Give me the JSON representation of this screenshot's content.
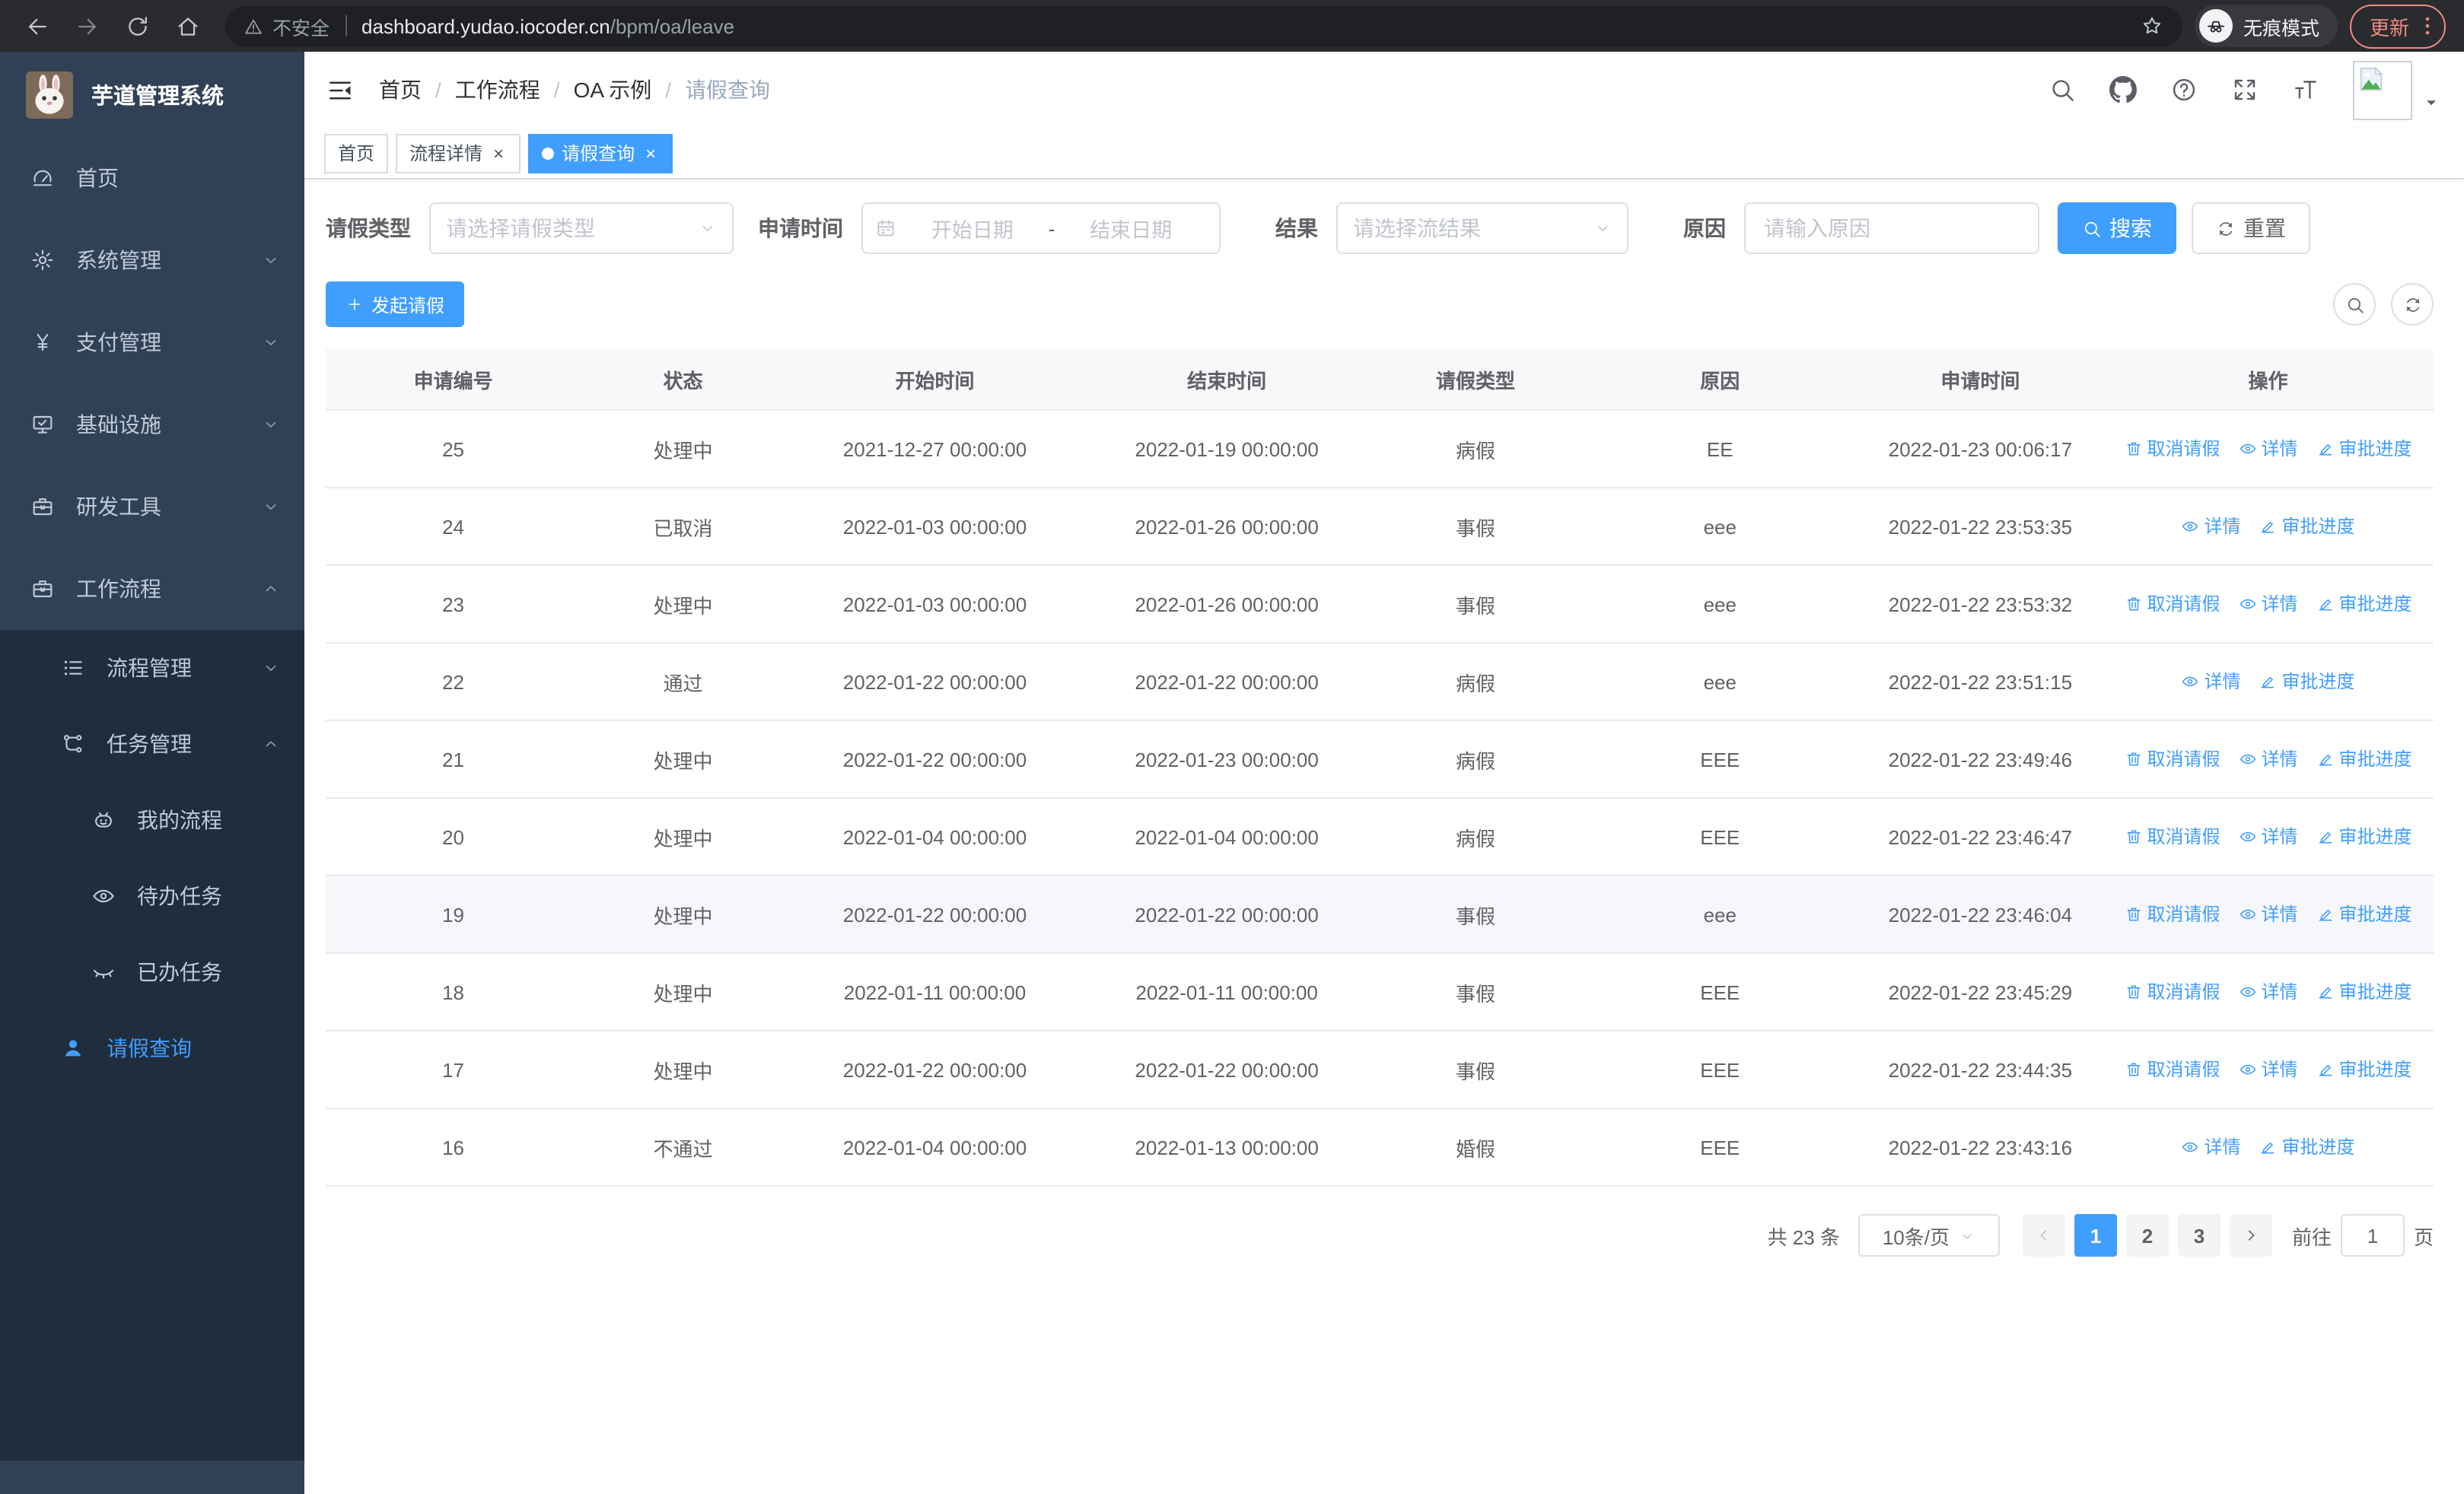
{
  "browser": {
    "nav_icons": [
      "back",
      "forward",
      "reload",
      "home"
    ],
    "security_label": "不安全",
    "url_host": "dashboard.yudao.iocoder.cn",
    "url_path": "/bpm/oa/leave",
    "incognito_label": "无痕模式",
    "update_label": "更新"
  },
  "sidebar": {
    "title": "芋道管理系统",
    "items": [
      {
        "label": "首页",
        "icon": "dashboard",
        "section": "top",
        "level": 0
      },
      {
        "label": "系统管理",
        "icon": "gear",
        "section": "top",
        "level": 0,
        "chevron": "down"
      },
      {
        "label": "支付管理",
        "icon": "yen",
        "section": "top",
        "level": 0,
        "chevron": "down"
      },
      {
        "label": "基础设施",
        "icon": "monitor",
        "section": "top",
        "level": 0,
        "chevron": "down"
      },
      {
        "label": "研发工具",
        "icon": "toolbox",
        "section": "top",
        "level": 0,
        "chevron": "down"
      },
      {
        "label": "工作流程",
        "icon": "toolbox",
        "section": "top",
        "level": 0,
        "chevron": "up"
      },
      {
        "label": "流程管理",
        "icon": "list",
        "section": "sub",
        "level": 1,
        "chevron": "down"
      },
      {
        "label": "任务管理",
        "icon": "flow",
        "section": "sub",
        "level": 1,
        "chevron": "up"
      },
      {
        "label": "我的流程",
        "icon": "robot",
        "section": "sub",
        "level": 2
      },
      {
        "label": "待办任务",
        "icon": "eye",
        "section": "sub",
        "level": 2
      },
      {
        "label": "已办任务",
        "icon": "eye-closed",
        "section": "sub",
        "level": 2
      },
      {
        "label": "请假查询",
        "icon": "user",
        "section": "sub",
        "level": 1,
        "active": true
      }
    ]
  },
  "header": {
    "breadcrumb": [
      "首页",
      "工作流程",
      "OA 示例",
      "请假查询"
    ],
    "right_icons": [
      "search",
      "github",
      "question",
      "fullscreen",
      "font-size"
    ]
  },
  "tabs": [
    {
      "label": "首页",
      "active": false,
      "closable": false
    },
    {
      "label": "流程详情",
      "active": false,
      "closable": true
    },
    {
      "label": "请假查询",
      "active": true,
      "closable": true
    }
  ],
  "filters": {
    "leave_type": {
      "label": "请假类型",
      "placeholder": "请选择请假类型"
    },
    "apply_time": {
      "label": "申请时间",
      "start_placeholder": "开始日期",
      "separator": "-",
      "end_placeholder": "结束日期"
    },
    "result": {
      "label": "结果",
      "placeholder": "请选择流结果"
    },
    "reason": {
      "label": "原因",
      "placeholder": "请输入原因"
    },
    "search_label": "搜索",
    "reset_label": "重置"
  },
  "toolbar": {
    "create_label": "发起请假"
  },
  "table": {
    "columns": [
      "申请编号",
      "状态",
      "开始时间",
      "结束时间",
      "请假类型",
      "原因",
      "申请时间",
      "操作"
    ],
    "action_labels": {
      "cancel": "取消请假",
      "detail": "详情",
      "progress": "审批进度"
    },
    "rows": [
      {
        "id": "25",
        "status": "处理中",
        "start": "2021-12-27 00:00:00",
        "end": "2022-01-19 00:00:00",
        "type": "病假",
        "reason": "EE",
        "apply": "2022-01-23 00:06:17",
        "actions": [
          "cancel",
          "detail",
          "progress"
        ],
        "hover": false
      },
      {
        "id": "24",
        "status": "已取消",
        "start": "2022-01-03 00:00:00",
        "end": "2022-01-26 00:00:00",
        "type": "事假",
        "reason": "eee",
        "apply": "2022-01-22 23:53:35",
        "actions": [
          "detail",
          "progress"
        ],
        "hover": false
      },
      {
        "id": "23",
        "status": "处理中",
        "start": "2022-01-03 00:00:00",
        "end": "2022-01-26 00:00:00",
        "type": "事假",
        "reason": "eee",
        "apply": "2022-01-22 23:53:32",
        "actions": [
          "cancel",
          "detail",
          "progress"
        ],
        "hover": false
      },
      {
        "id": "22",
        "status": "通过",
        "start": "2022-01-22 00:00:00",
        "end": "2022-01-22 00:00:00",
        "type": "病假",
        "reason": "eee",
        "apply": "2022-01-22 23:51:15",
        "actions": [
          "detail",
          "progress"
        ],
        "hover": false
      },
      {
        "id": "21",
        "status": "处理中",
        "start": "2022-01-22 00:00:00",
        "end": "2022-01-23 00:00:00",
        "type": "病假",
        "reason": "EEE",
        "apply": "2022-01-22 23:49:46",
        "actions": [
          "cancel",
          "detail",
          "progress"
        ],
        "hover": false
      },
      {
        "id": "20",
        "status": "处理中",
        "start": "2022-01-04 00:00:00",
        "end": "2022-01-04 00:00:00",
        "type": "病假",
        "reason": "EEE",
        "apply": "2022-01-22 23:46:47",
        "actions": [
          "cancel",
          "detail",
          "progress"
        ],
        "hover": false
      },
      {
        "id": "19",
        "status": "处理中",
        "start": "2022-01-22 00:00:00",
        "end": "2022-01-22 00:00:00",
        "type": "事假",
        "reason": "eee",
        "apply": "2022-01-22 23:46:04",
        "actions": [
          "cancel",
          "detail",
          "progress"
        ],
        "hover": true
      },
      {
        "id": "18",
        "status": "处理中",
        "start": "2022-01-11 00:00:00",
        "end": "2022-01-11 00:00:00",
        "type": "事假",
        "reason": "EEE",
        "apply": "2022-01-22 23:45:29",
        "actions": [
          "cancel",
          "detail",
          "progress"
        ],
        "hover": false
      },
      {
        "id": "17",
        "status": "处理中",
        "start": "2022-01-22 00:00:00",
        "end": "2022-01-22 00:00:00",
        "type": "事假",
        "reason": "EEE",
        "apply": "2022-01-22 23:44:35",
        "actions": [
          "cancel",
          "detail",
          "progress"
        ],
        "hover": false
      },
      {
        "id": "16",
        "status": "不通过",
        "start": "2022-01-04 00:00:00",
        "end": "2022-01-13 00:00:00",
        "type": "婚假",
        "reason": "EEE",
        "apply": "2022-01-22 23:43:16",
        "actions": [
          "detail",
          "progress"
        ],
        "hover": false
      }
    ]
  },
  "pagination": {
    "total_label": "共 23 条",
    "page_size_label": "10条/页",
    "pages": [
      "1",
      "2",
      "3"
    ],
    "active_page": "1",
    "goto_label": "前往",
    "goto_value": "1",
    "page_unit_label": "页"
  },
  "colors": {
    "accent": "#409eff",
    "sidebar_bg": "#304156",
    "submenu_bg": "#1f2d3d",
    "sidebar_text": "#bfcbd9",
    "update_accent": "#f08b82"
  }
}
